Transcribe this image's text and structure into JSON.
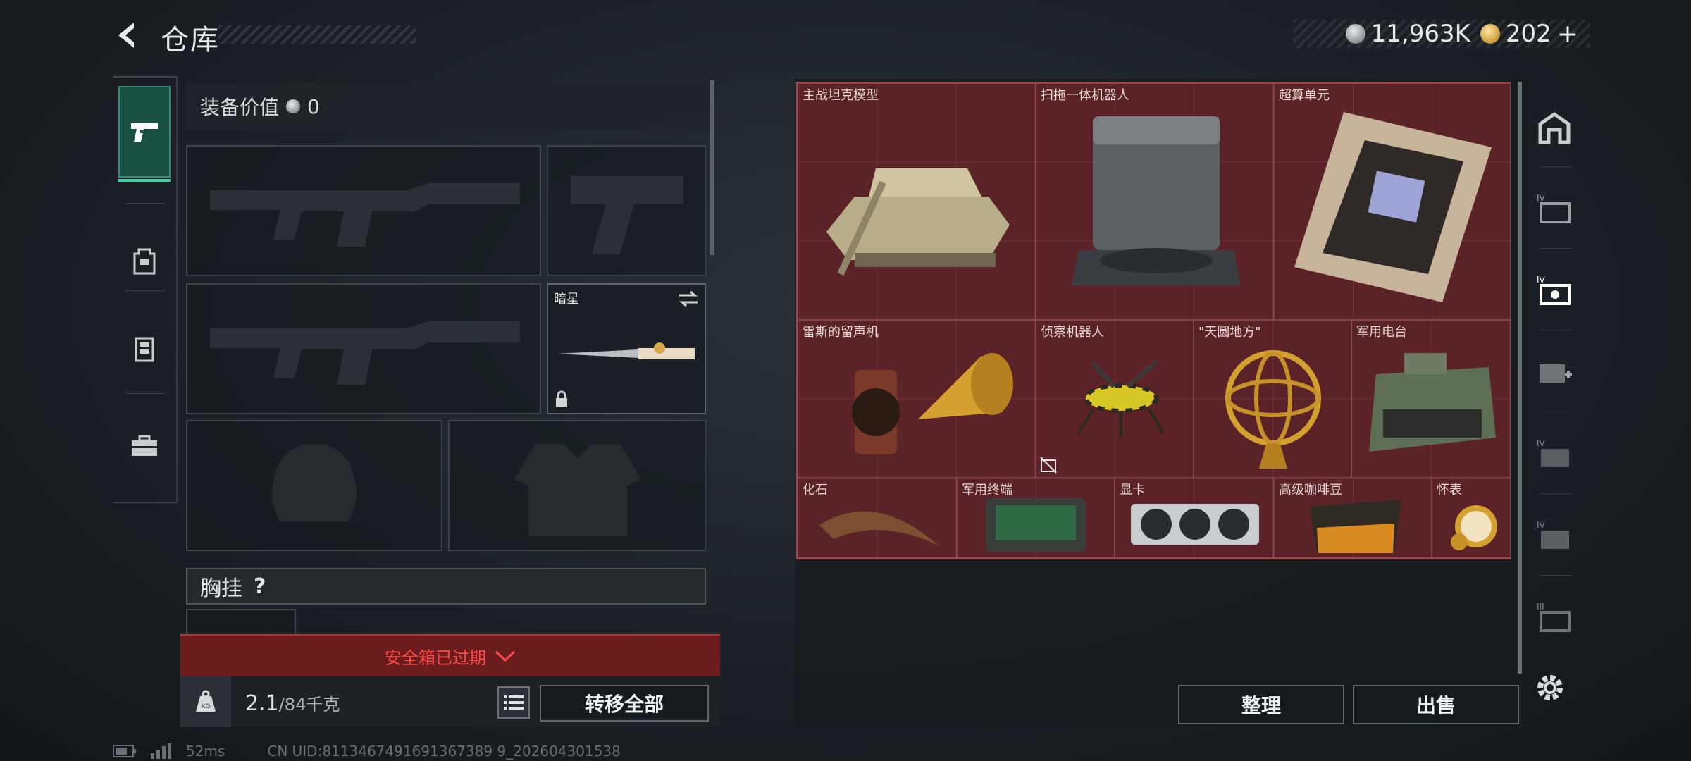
{
  "header": {
    "title": "仓库",
    "currency": [
      {
        "icon": "silver-coin-icon",
        "value": "11,963K"
      },
      {
        "icon": "gold-coin-icon",
        "value": "202"
      }
    ],
    "add_symbol": "+"
  },
  "left_tabs": [
    {
      "icon": "pistol-icon",
      "active": true
    },
    {
      "icon": "backpack-icon",
      "active": false
    },
    {
      "icon": "vest-icon",
      "active": false
    },
    {
      "icon": "toolbox-icon",
      "active": false
    }
  ],
  "equipment": {
    "value_label": "装备价值",
    "value": "0",
    "melee_label": "暗星",
    "chest_label": "胸挂",
    "chest_help": "?"
  },
  "safebox": {
    "text": "安全箱已过期"
  },
  "weight": {
    "current": "2.1",
    "max": "/84千克",
    "icon_text": "KG"
  },
  "buttons": {
    "transfer_all": "转移全部",
    "sort": "整理",
    "sell": "出售"
  },
  "storage_items": [
    {
      "label": "主战坦克模型"
    },
    {
      "label": "扫拖一体机器人"
    },
    {
      "label": "超算单元"
    },
    {
      "label": "雷斯的留声机"
    },
    {
      "label": "侦察机器人"
    },
    {
      "label": "\"天圆地方\""
    },
    {
      "label": "军用电台"
    },
    {
      "label": "化石"
    },
    {
      "label": "军用终端"
    },
    {
      "label": "显卡"
    },
    {
      "label": "高级咖啡豆"
    },
    {
      "label": "怀表"
    }
  ],
  "right_tabs": [
    "home-icon",
    "storage-iv-icon",
    "storage-iv-icon",
    "medkit-icon",
    "storage-iv-icon",
    "storage-iv-icon",
    "storage-iv-icon"
  ],
  "footer": {
    "ping": "52ms",
    "uid": "CN UID:8113467491691367389 9_202604301538"
  },
  "colors": {
    "accent": "#47d4a5",
    "alert": "#ff4a4a",
    "storage_bg": "#5d2227"
  }
}
